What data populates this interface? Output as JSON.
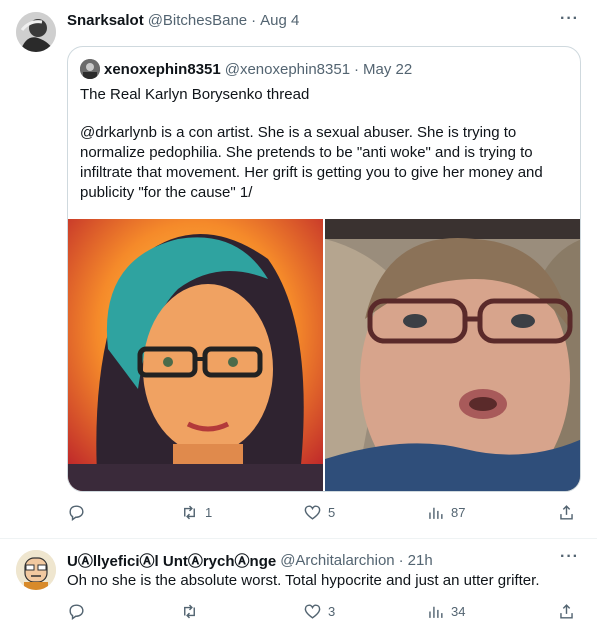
{
  "tweet": {
    "author_name": "Snarksalot",
    "author_handle": "@BitchesBane",
    "separator": "·",
    "date": "Aug 4",
    "more_label": "···",
    "quote": {
      "author_name": "xenoxephin8351",
      "author_handle": "@xenoxephin8351",
      "separator": "·",
      "date": "May 22",
      "title": "The Real Karlyn Borysenko thread",
      "body": "@drkarlynb is a con artist. She is a sexual abuser. She is trying to normalize pedophilia. She pretends to be \"anti woke\" and is trying to infiltrate that movement. Her grift is getting you to give her money and publicity \"for the cause\" 1/"
    },
    "actions": {
      "reply_count": "",
      "retweet_count": "1",
      "like_count": "5",
      "view_count": "87"
    }
  },
  "reply": {
    "author_name": "UⒶllyeficiⒶl UntⒶrychⒶnge",
    "author_handle": "@Architalarchion",
    "separator": "·",
    "date": "21h",
    "more_label": "···",
    "text": "Oh no she is the absolute worst. Total hypocrite and just an utter grifter.",
    "actions": {
      "reply_count": "",
      "retweet_count": "",
      "like_count": "3",
      "view_count": "34"
    }
  },
  "colors": {
    "text_primary": "#0f1419",
    "text_secondary": "#536471",
    "border": "#cfd9de"
  },
  "icons": [
    "reply-icon",
    "retweet-icon",
    "like-icon",
    "views-icon",
    "share-icon",
    "more-icon"
  ]
}
